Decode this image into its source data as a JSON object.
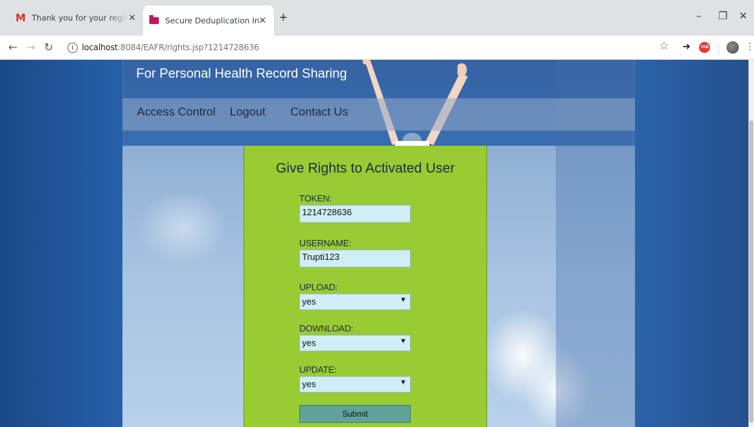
{
  "browser": {
    "tabs": [
      {
        "title": "Thank you for your registration w",
        "icon": "gmail-icon",
        "active": false
      },
      {
        "title": "Secure Deduplication In Cloud",
        "icon": "folder-icon",
        "active": true
      }
    ],
    "new_tab_label": "+",
    "url_host": "localhost",
    "url_rest": ":8084/EAFR/rights.jsp?1214728636",
    "extension_badge": "YAB"
  },
  "site": {
    "title": "For Personal Health Record Sharing",
    "nav": [
      "Access Control",
      "Logout",
      "Contact Us"
    ]
  },
  "form": {
    "heading": "Give Rights to Activated User",
    "token_label": "TOKEN:",
    "token_value": "1214728636",
    "username_label": "USERNAME:",
    "username_value": "Trupti123",
    "upload_label": "UPLOAD:",
    "upload_value": "yes",
    "download_label": "DOWNLOAD:",
    "download_value": "yes",
    "update_label": "UPDATE:",
    "update_value": "yes",
    "submit_label": "Submit"
  },
  "colors": {
    "form_bg": "#99cc33",
    "input_bg": "#cfeef5",
    "submit_bg": "#5fa39b"
  }
}
